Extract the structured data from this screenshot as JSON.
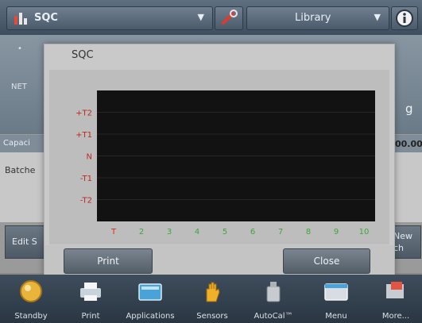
{
  "header": {
    "app_name": "SQC",
    "library_label": "Library"
  },
  "background": {
    "net_label": "NET",
    "unit": "g",
    "capacity_label": "Capaci",
    "capacity_value": "00.00",
    "batches_label": "Batche",
    "edit_label": "Edit S",
    "new_label": "New",
    "new_sub": "ch"
  },
  "dialog": {
    "title": "SQC",
    "print_label": "Print",
    "close_label": "Close"
  },
  "chart_data": {
    "type": "line",
    "y_tick_labels": [
      "+T2",
      "+T1",
      "N",
      "-T1",
      "-T2"
    ],
    "x_tick_labels": [
      "T",
      "2",
      "3",
      "4",
      "5",
      "6",
      "7",
      "8",
      "9",
      "10"
    ],
    "series": [],
    "grid": true,
    "colors": {
      "plot_background": "#121212",
      "y_labels": "#c0281e",
      "x_first": "#e02a1c",
      "x_rest": "#3fa63c"
    }
  },
  "nav": {
    "items": [
      {
        "label": "Standby",
        "icon": "standby-icon"
      },
      {
        "label": "Print",
        "icon": "printer-icon"
      },
      {
        "label": "Applications",
        "icon": "applications-icon"
      },
      {
        "label": "Sensors",
        "icon": "sensor-hand-icon"
      },
      {
        "label": "AutoCal™",
        "icon": "autocal-weight-icon"
      },
      {
        "label": "Menu",
        "icon": "menu-window-icon"
      },
      {
        "label": "More...",
        "icon": "more-icon"
      }
    ]
  }
}
